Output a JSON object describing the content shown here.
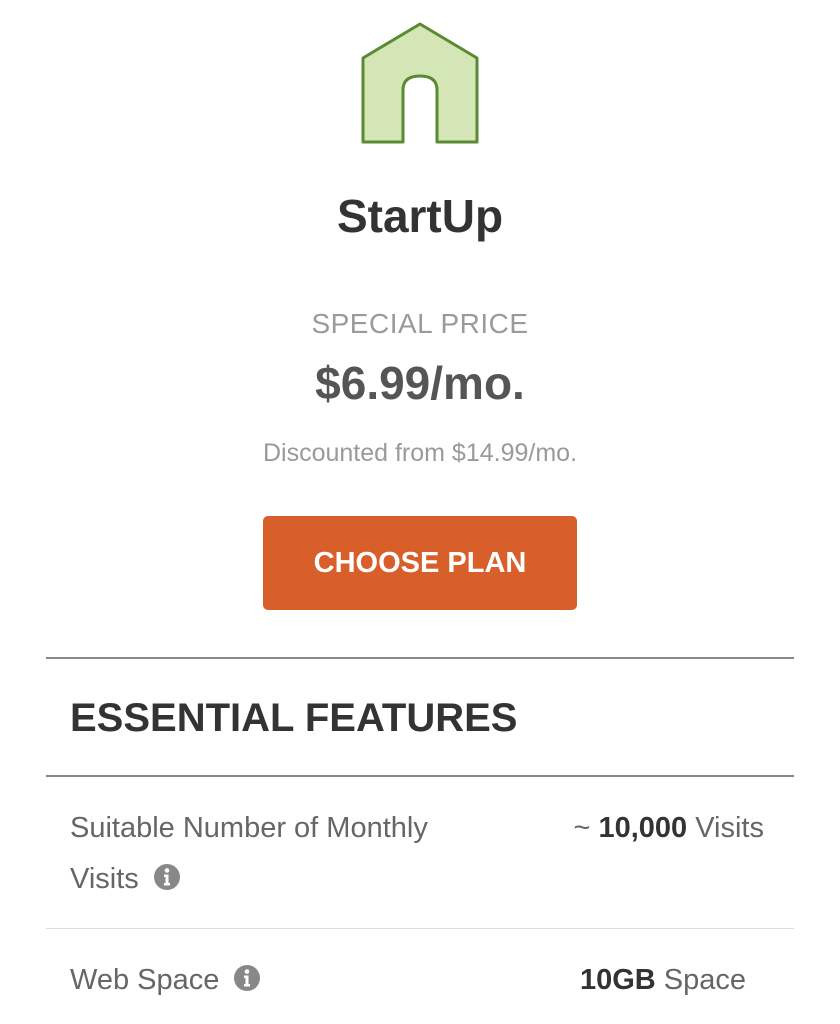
{
  "plan": {
    "icon": "house-icon",
    "icon_colors": {
      "fill": "#d4e6b5",
      "stroke": "#5a8a32"
    },
    "name": "StartUp",
    "special_label": "SPECIAL PRICE",
    "price": "$6.99/mo.",
    "discount_text": "Discounted from $14.99/mo.",
    "cta_label": "CHOOSE PLAN",
    "cta_color": "#d85e2a"
  },
  "features": {
    "title": "ESSENTIAL FEATURES",
    "rows": [
      {
        "label_line1": "Suitable Number of Monthly",
        "label_line2": "Visits",
        "info_icon": "info-icon",
        "value_prefix": "~ ",
        "value_bold": "10,000",
        "value_suffix": " Visits"
      },
      {
        "label_line1": "Web Space",
        "info_icon": "info-icon",
        "value_bold": "10GB",
        "value_suffix": " Space"
      }
    ]
  }
}
